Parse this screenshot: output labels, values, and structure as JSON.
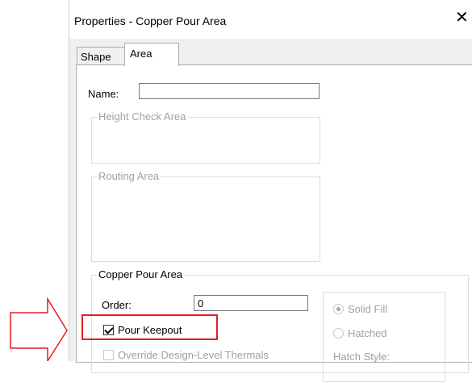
{
  "dialog": {
    "title": "Properties - Copper Pour Area",
    "close_icon": "close-icon",
    "tabs": [
      {
        "label": "Shape",
        "active": false
      },
      {
        "label": "Area",
        "active": true
      }
    ]
  },
  "area_tab": {
    "name_label": "Name:",
    "name_value": "",
    "height_check_area_title": "Height Check Area",
    "routing_area_title": "Routing Area",
    "copper_pour_area": {
      "title": "Copper Pour Area",
      "order_label": "Order:",
      "order_value": "0",
      "pour_keepout_label": "Pour Keepout",
      "pour_keepout_checked": true,
      "override_label": "Override Design-Level Thermals",
      "override_checked": false,
      "fill_options": [
        {
          "label": "Solid Fill",
          "selected": true
        },
        {
          "label": "Hatched",
          "selected": false
        }
      ],
      "hatch_style_label": "Hatch Style:"
    }
  },
  "annotation": {
    "arrow_color": "#e02020",
    "highlight_color": "#e02020"
  }
}
